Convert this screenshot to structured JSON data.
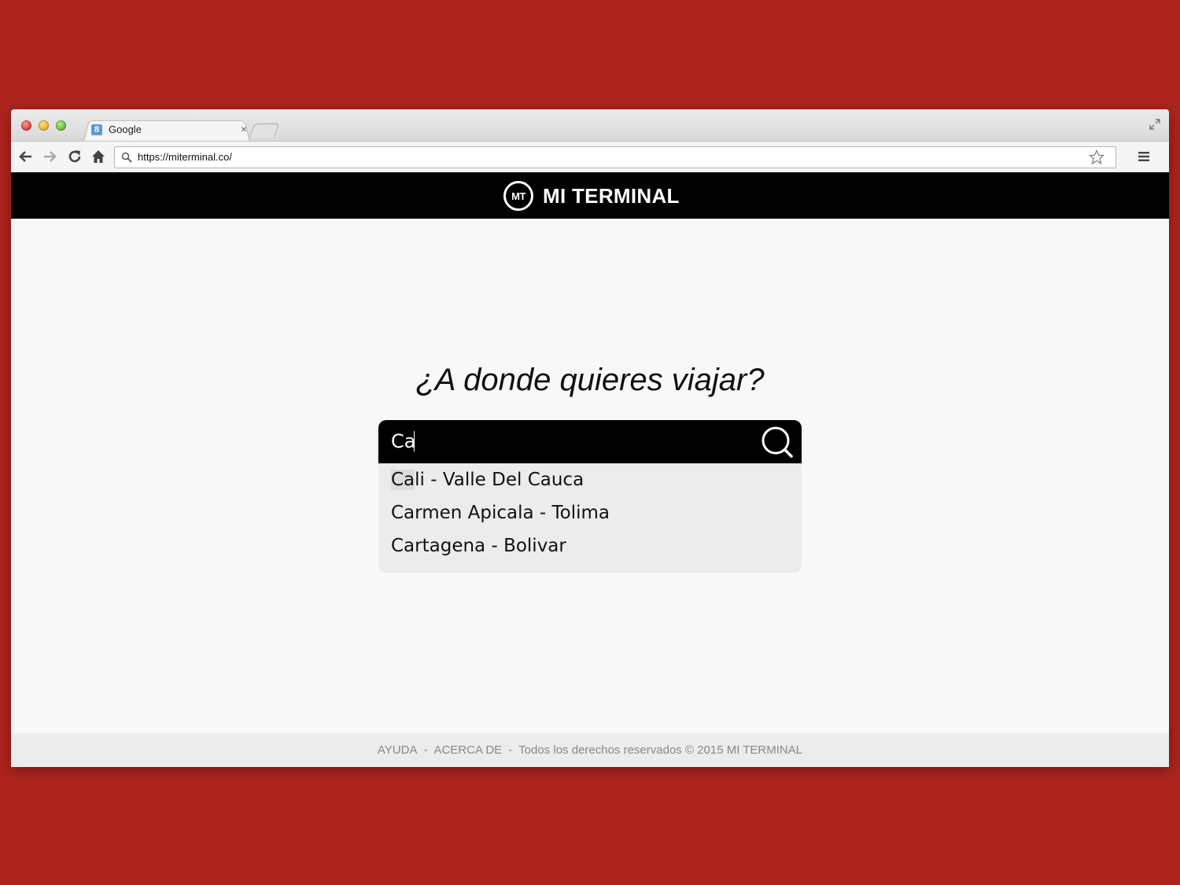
{
  "browser": {
    "tab_title": "Google",
    "tab_favicon": "8",
    "tab_close": "×",
    "url": "https://miterminal.co/"
  },
  "site": {
    "brand_logo": "MT",
    "brand_name": "MI TERMINAL",
    "question": "¿A donde quieres viajar?",
    "search_value": "Ca",
    "suggestions": [
      {
        "match": "Ca",
        "rest": "li - Valle Del Cauca"
      },
      {
        "match": "",
        "rest": "Carmen Apicala - Tolima"
      },
      {
        "match": "",
        "rest": "Cartagena - Bolivar"
      }
    ],
    "footer": {
      "help": "AYUDA",
      "about": "ACERCA DE",
      "separator": "-",
      "rights": "Todos los derechos reservados © 2015 MI TERMINAL"
    }
  },
  "colors": {
    "background": "#ae241d",
    "header": "#000000",
    "suggestions_bg": "#ececec"
  }
}
